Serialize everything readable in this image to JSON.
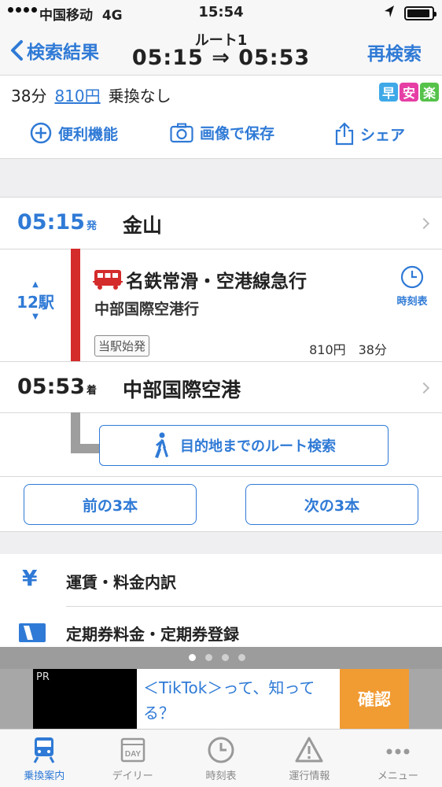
{
  "status_bar": {
    "carrier": "中国移动",
    "network": "4G",
    "time": "15:54"
  },
  "nav": {
    "back_label": "検索結果",
    "title": "ルート1",
    "subtitle": "05:15 ⇒ 05:53",
    "research_label": "再検索"
  },
  "summary": {
    "duration": "38分",
    "fare": "810円",
    "transfers": "乗換なし",
    "badges": [
      {
        "label": "早",
        "color": "#3fa9e8"
      },
      {
        "label": "安",
        "color": "#e63ea5"
      },
      {
        "label": "楽",
        "color": "#55c24a"
      }
    ]
  },
  "tools": {
    "convenience": "便利機能",
    "save_image": "画像で保存",
    "share": "シェア"
  },
  "route": {
    "departure": {
      "time": "05:15",
      "suffix": "発",
      "station": "金山"
    },
    "segment": {
      "stops": "12駅",
      "train_name": "名鉄常滑・空港線急行",
      "destination": "中部国際空港行",
      "start_note": "当駅始発",
      "fare": "810円",
      "duration": "38分",
      "timetable_label": "時刻表",
      "line_color": "#d42b2b"
    },
    "arrival": {
      "time": "05:53",
      "suffix": "着",
      "station": "中部国際空港"
    },
    "walk_button": "目的地までのルート検索"
  },
  "pagination": {
    "prev": "前の3本",
    "next": "次の3本"
  },
  "info_list": [
    {
      "icon": "yen-icon",
      "label": "運賃・料金内訳"
    },
    {
      "icon": "commuter-pass-icon",
      "label": "定期券料金・定期券登録"
    }
  ],
  "ad": {
    "pr": "PR",
    "text": "＜TikTok＞って、知ってる？",
    "button": "確認"
  },
  "tab_bar": [
    {
      "label": "乗換案内",
      "icon": "train-icon",
      "active": true
    },
    {
      "label": "デイリー",
      "icon": "day-calendar-icon",
      "active": false
    },
    {
      "label": "時刻表",
      "icon": "clock-icon",
      "active": false
    },
    {
      "label": "運行情報",
      "icon": "warning-icon",
      "active": false
    },
    {
      "label": "メニュー",
      "icon": "more-icon",
      "active": false
    }
  ],
  "colors": {
    "accent": "#2f7ad6",
    "line_red": "#d42b2b",
    "ad_button": "#f19b33"
  }
}
